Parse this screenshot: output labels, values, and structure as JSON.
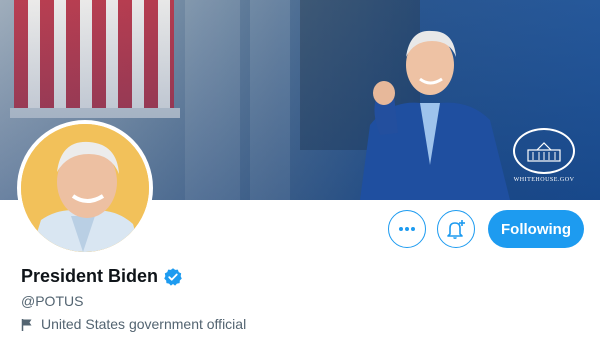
{
  "profile": {
    "display_name": "President Biden",
    "handle": "@POTUS",
    "label": "United States government official",
    "verified": true,
    "avatar_background": "#f2c15a"
  },
  "banner": {
    "seal_text": "WHITEHOUSE.GOV"
  },
  "actions": {
    "more_icon": "ellipsis-icon",
    "notifications_icon": "bell-plus-icon",
    "following_label": "Following"
  },
  "colors": {
    "accent": "#1d9bf0",
    "name_text": "#0f1419",
    "secondary_text": "#536471"
  }
}
